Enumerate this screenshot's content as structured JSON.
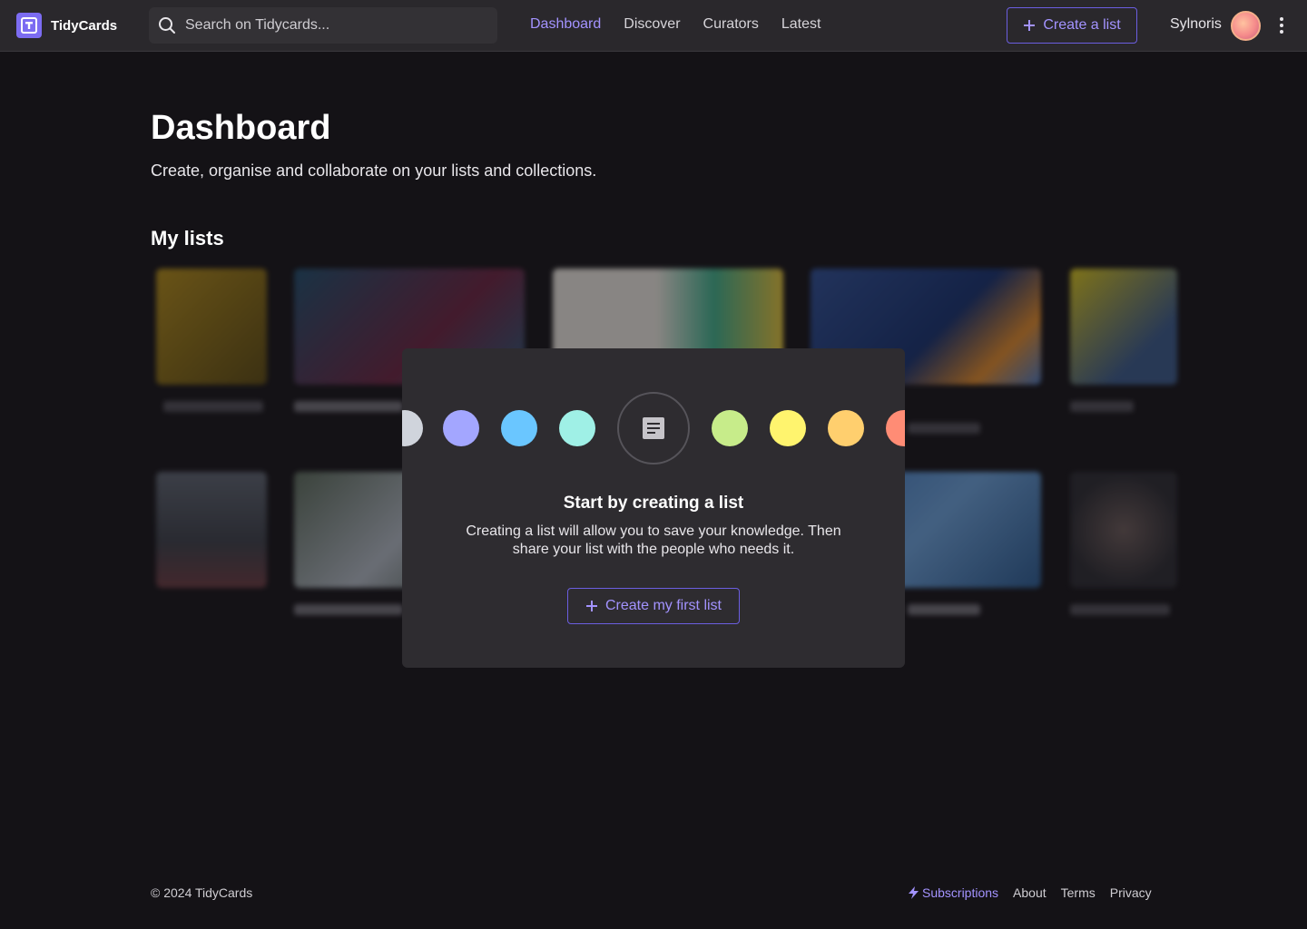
{
  "app": {
    "name": "TidyCards",
    "brand_color": "#7c6cf2",
    "accent_color": "#a393ff"
  },
  "search": {
    "placeholder": "Search on Tidycards..."
  },
  "nav": {
    "items": [
      {
        "label": "Dashboard",
        "active": true
      },
      {
        "label": "Discover",
        "active": false
      },
      {
        "label": "Curators",
        "active": false
      },
      {
        "label": "Latest",
        "active": false
      }
    ]
  },
  "header": {
    "create_label": "Create a list",
    "user_name": "Sylnoris"
  },
  "main": {
    "title": "Dashboard",
    "subtitle": "Create, organise and collaborate on your lists and collections.",
    "section_title": "My lists"
  },
  "modal": {
    "title": "Start by creating a list",
    "text": "Creating a list will allow you to save your knowledge. Then share your list with the people who needs it.",
    "button_label": "Create my first list",
    "center_icon": "document-icon",
    "dot_colors": [
      "#d0d4dc",
      "#a3a6ff",
      "#6ac6ff",
      "#9ff0e6",
      "#c7ec8a",
      "#fff46e",
      "#ffcf6e",
      "#ff8c75"
    ]
  },
  "footer": {
    "copyright": "© 2024 TidyCards",
    "links": [
      "Subscriptions",
      "About",
      "Terms",
      "Privacy"
    ]
  }
}
